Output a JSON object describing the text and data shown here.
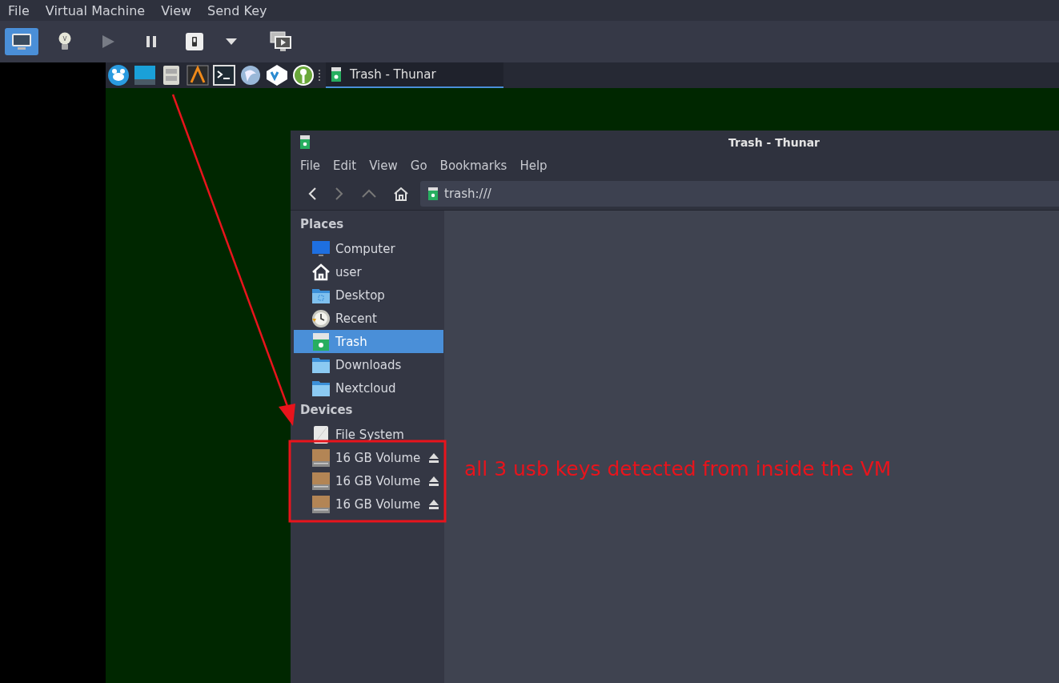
{
  "host_menu": [
    "File",
    "Virtual Machine",
    "View",
    "Send Key"
  ],
  "host_toolbar": [
    {
      "kind": "console",
      "selected": true
    },
    {
      "kind": "details",
      "selected": false
    },
    {
      "kind": "play",
      "selected": false
    },
    {
      "kind": "pause",
      "selected": false
    },
    {
      "kind": "power",
      "selected": false
    },
    {
      "kind": "dropdown",
      "selected": false
    },
    {
      "kind": "snapshots",
      "selected": false
    }
  ],
  "guest_panel": {
    "launchers": [
      {
        "kind": "whisker"
      },
      {
        "kind": "desktop"
      },
      {
        "kind": "files"
      },
      {
        "kind": "editor"
      },
      {
        "kind": "terminal"
      },
      {
        "kind": "browser"
      },
      {
        "kind": "vscode"
      },
      {
        "kind": "keys"
      }
    ],
    "tasks": [
      {
        "title": "Trash - Thunar",
        "selected": true
      }
    ]
  },
  "thunar": {
    "title": "Trash - Thunar",
    "menu": [
      "File",
      "Edit",
      "View",
      "Go",
      "Bookmarks",
      "Help"
    ],
    "location": "trash:///",
    "sidebar": [
      {
        "heading": "Places",
        "items": [
          {
            "label": "Computer",
            "kind": "computer",
            "selected": false,
            "ejectable": false
          },
          {
            "label": "user",
            "kind": "home",
            "selected": false,
            "ejectable": false
          },
          {
            "label": "Desktop",
            "kind": "desktop",
            "selected": false,
            "ejectable": false
          },
          {
            "label": "Recent",
            "kind": "recent",
            "selected": false,
            "ejectable": false
          },
          {
            "label": "Trash",
            "kind": "trash",
            "selected": true,
            "ejectable": false
          },
          {
            "label": "Downloads",
            "kind": "folder",
            "selected": false,
            "ejectable": false
          },
          {
            "label": "Nextcloud",
            "kind": "folder",
            "selected": false,
            "ejectable": false
          }
        ]
      },
      {
        "heading": "Devices",
        "items": [
          {
            "label": "File System",
            "kind": "filesystem",
            "selected": false,
            "ejectable": false
          },
          {
            "label": "16 GB Volume",
            "kind": "drive",
            "selected": false,
            "ejectable": true
          },
          {
            "label": "16 GB Volume",
            "kind": "drive",
            "selected": false,
            "ejectable": true
          },
          {
            "label": "16 GB Volume",
            "kind": "drive",
            "selected": false,
            "ejectable": true
          }
        ]
      }
    ]
  },
  "annotation": {
    "text": "all 3 usb keys detected from inside the VM"
  }
}
